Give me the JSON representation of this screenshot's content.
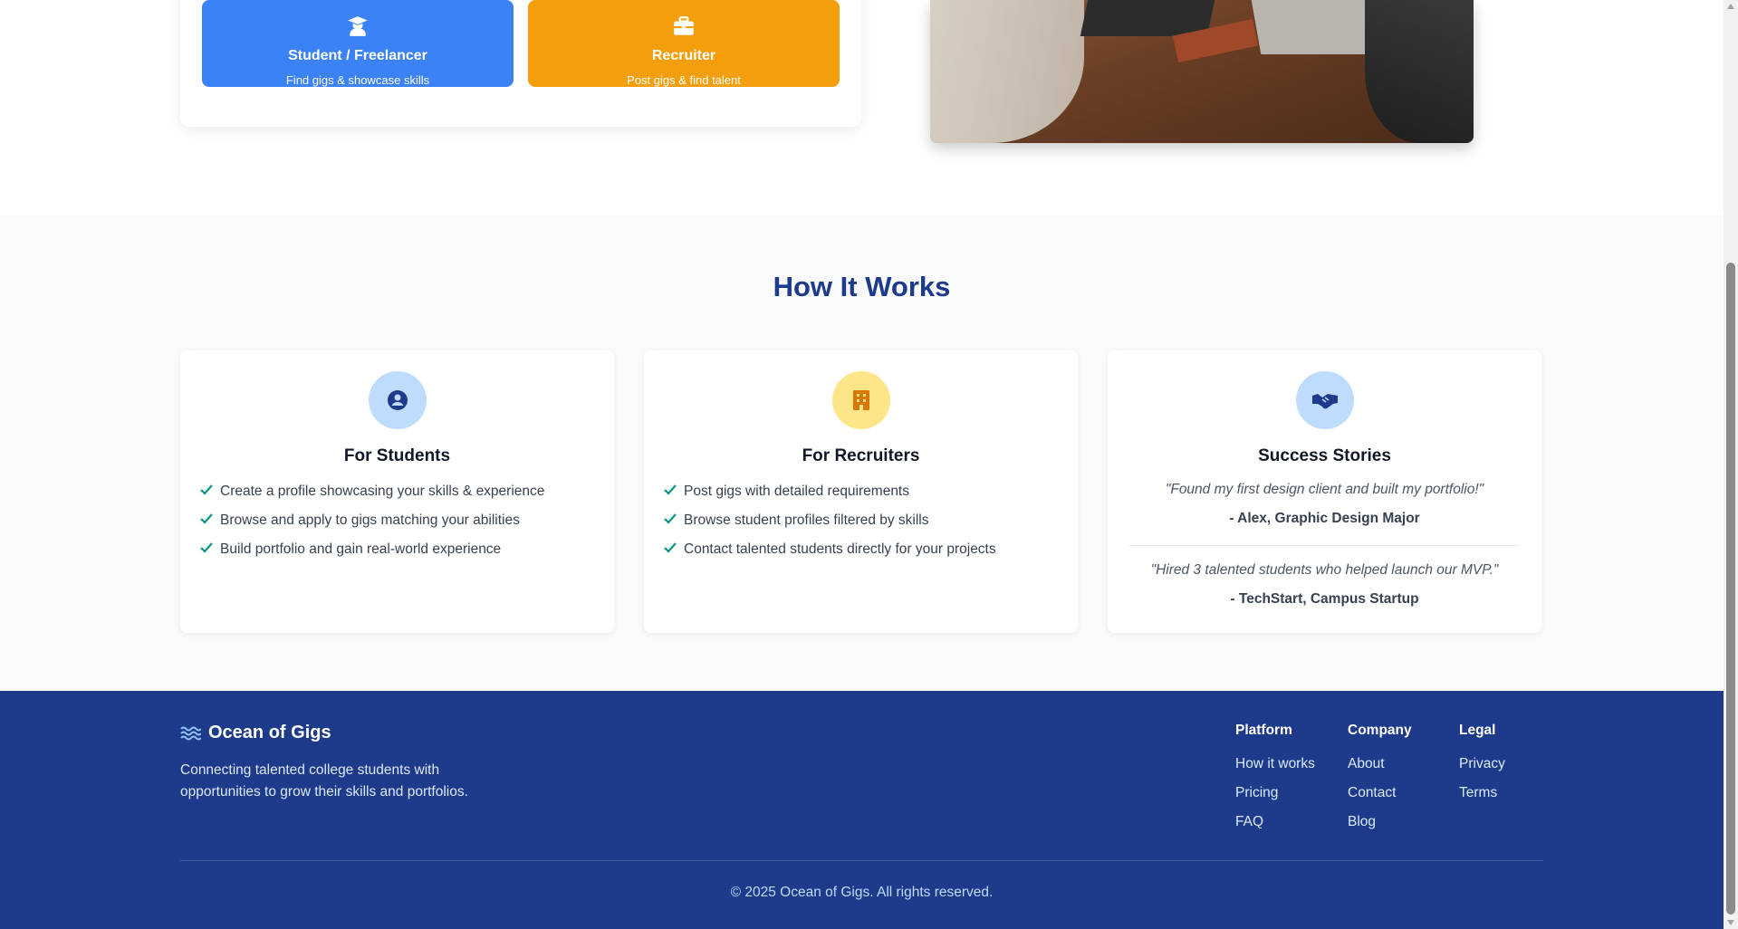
{
  "role_select": {
    "student": {
      "title": "Student / Freelancer",
      "subtitle": "Find gigs & showcase skills",
      "icon": "graduate-icon"
    },
    "recruiter": {
      "title": "Recruiter",
      "subtitle": "Post gigs & find talent",
      "icon": "briefcase-icon"
    }
  },
  "how_it_works": {
    "title": "How It Works",
    "students": {
      "title": "For Students",
      "icon": "user-circle-icon",
      "items": [
        "Create a profile showcasing your skills & experience",
        "Browse and apply to gigs matching your abilities",
        "Build portfolio and gain real-world experience"
      ]
    },
    "recruiters": {
      "title": "For Recruiters",
      "icon": "building-icon",
      "items": [
        "Post gigs with detailed requirements",
        "Browse student profiles filtered by skills",
        "Contact talented students directly for your projects"
      ]
    },
    "stories": {
      "title": "Success Stories",
      "icon": "handshake-icon",
      "testimonials": [
        {
          "quote": "\"Found my first design client and built my portfolio!\"",
          "author": "- Alex, Graphic Design Major"
        },
        {
          "quote": "\"Hired 3 talented students who helped launch our MVP.\"",
          "author": "- TechStart, Campus Startup"
        }
      ]
    }
  },
  "footer": {
    "brand": "Ocean of Gigs",
    "tagline": "Connecting talented college students with opportunities to grow their skills and portfolios.",
    "columns": [
      {
        "heading": "Platform",
        "links": [
          "How it works",
          "Pricing",
          "FAQ"
        ]
      },
      {
        "heading": "Company",
        "links": [
          "About",
          "Contact",
          "Blog"
        ]
      },
      {
        "heading": "Legal",
        "links": [
          "Privacy",
          "Terms"
        ]
      }
    ],
    "copyright": "© 2025 Ocean of Gigs. All rights reserved."
  },
  "colors": {
    "primary_blue": "#3b82f6",
    "accent_orange": "#f59e0b",
    "navy": "#1e3a8a",
    "check_green": "#0d9488"
  }
}
